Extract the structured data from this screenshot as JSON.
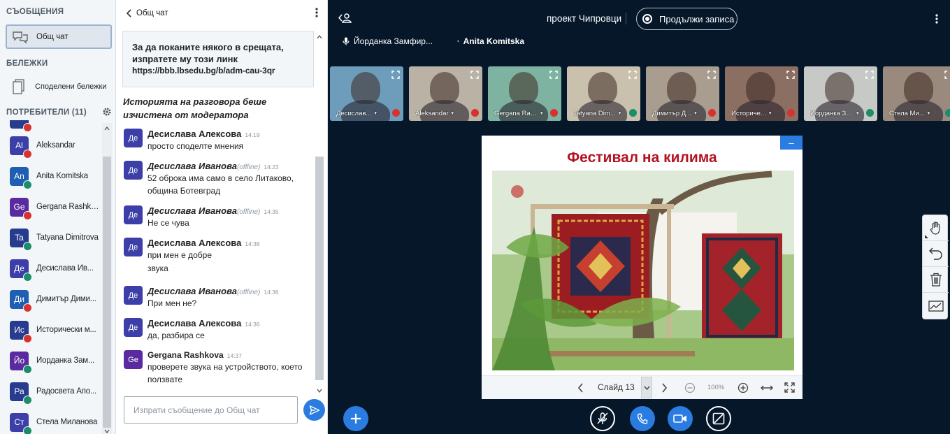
{
  "sidebar": {
    "messages_title": "СЪОБЩЕНИЯ",
    "public_chat": "Общ чат",
    "notes_title": "БЕЛЕЖКИ",
    "shared_notes": "Споделени бележки",
    "users_title": "ПОТРЕБИТЕЛИ (11)",
    "users": [
      {
        "initials": "Al",
        "name": "Aleksandar",
        "color": "#3d3fa8",
        "status": "muted"
      },
      {
        "initials": "An",
        "name": "Anita Komitska",
        "color": "#1e5fb3",
        "status": "listen"
      },
      {
        "initials": "Ge",
        "name": "Gergana Rashkova",
        "color": "#5a2ba0",
        "status": "muted"
      },
      {
        "initials": "Ta",
        "name": "Tatyana Dimitrova",
        "color": "#273c8f",
        "status": "listen"
      },
      {
        "initials": "Де",
        "name": "Десислава Ив...",
        "color": "#3d3fa8",
        "status": "listen"
      },
      {
        "initials": "Ди",
        "name": "Димитър Дими...",
        "color": "#1e5fb3",
        "status": "muted"
      },
      {
        "initials": "Ис",
        "name": "Исторически м...",
        "color": "#273c8f",
        "status": "muted"
      },
      {
        "initials": "Йо",
        "name": "Йорданка Зам...",
        "color": "#5a2ba0",
        "status": "listen"
      },
      {
        "initials": "Ра",
        "name": "Радосвета Апо...",
        "color": "#273c8f",
        "status": "listen"
      },
      {
        "initials": "Ст",
        "name": "Стела Миланова",
        "color": "#3d3fa8",
        "status": "listen"
      }
    ]
  },
  "chat": {
    "back_label": "Общ чат",
    "invite_text": "За да поканите някого в срещата, изпратете му този линк",
    "invite_link": "https://bbb.lbsedu.bg/b/adm-cau-3qr",
    "cleared_notice": "Историята на разговора беше изчистена от модератора",
    "offline_tag": "(offline)",
    "messages": [
      {
        "initials": "Де",
        "color": "#3d3fa8",
        "name": "Десислава Алексова",
        "offline": false,
        "time": "14:19",
        "lines": [
          "просто споделте мнения"
        ]
      },
      {
        "initials": "Де",
        "color": "#3d3fa8",
        "name": "Десислава Иванова",
        "offline": true,
        "time": "14:23",
        "lines": [
          "52 оброка има само в село Литаково, община Ботевград"
        ]
      },
      {
        "initials": "Де",
        "color": "#3d3fa8",
        "name": "Десислава Иванова",
        "offline": true,
        "time": "14:35",
        "lines": [
          "Не се чува"
        ]
      },
      {
        "initials": "Де",
        "color": "#3d3fa8",
        "name": "Десислава Алексова",
        "offline": false,
        "time": "14:36",
        "lines": [
          "при мен е добре",
          "звука"
        ]
      },
      {
        "initials": "Де",
        "color": "#3d3fa8",
        "name": "Десислава Иванова",
        "offline": true,
        "time": "14:36",
        "lines": [
          "При мен не?"
        ]
      },
      {
        "initials": "Де",
        "color": "#3d3fa8",
        "name": "Десислава Алексова",
        "offline": false,
        "time": "14:36",
        "lines": [
          "да, разбира се"
        ]
      },
      {
        "initials": "Ge",
        "color": "#5a2ba0",
        "name": "Gergana Rashkova",
        "offline": false,
        "time": "14:37",
        "lines": [
          "проверете звука на устройството, което ползвате"
        ]
      }
    ],
    "input_placeholder": "Изпрати съобщение до Общ чат"
  },
  "main": {
    "meeting_title": "проект Чипровци",
    "record_label": "Продължи записа",
    "talkers": [
      {
        "name": "Йорданка Замфир...",
        "color": "#4b2e9e"
      },
      {
        "name": "Anita Komitska",
        "color": "#1e63c2"
      }
    ],
    "tiles": [
      {
        "name": "Десислав...",
        "status": "muted",
        "bg": "#6e9dbb"
      },
      {
        "name": "Aleksandar",
        "status": "muted",
        "bg": "#b9b2a5"
      },
      {
        "name": "Gergana Ras...",
        "status": "muted",
        "bg": "#7fb3a1"
      },
      {
        "name": "Tatyana Dim...",
        "status": "listen",
        "bg": "#c9c0ad"
      },
      {
        "name": "Димитър Д...",
        "status": "muted",
        "bg": "#a89d8e"
      },
      {
        "name": "Историче...",
        "status": "muted",
        "bg": "#8b6f62"
      },
      {
        "name": "Йорданка За...",
        "status": "listen",
        "bg": "#c7c9c6"
      },
      {
        "name": "Стела Ми...",
        "status": "listen",
        "bg": "#9a8a7d"
      }
    ],
    "slide": {
      "title": "Фестивал на килима",
      "slide_label": "Слайд 13",
      "zoom": "100%"
    }
  },
  "colors": {
    "accent": "#2a7ce0",
    "muted": "#d8322f",
    "listen": "#1a8d6a",
    "background": "#06172a"
  },
  "icons": [
    "chat-bubbles-icon",
    "notes-icon",
    "gear-icon",
    "kebab-icon",
    "send-icon",
    "user-leave-icon",
    "record-icon",
    "mic-icon",
    "expand-icon",
    "hand-icon",
    "undo-icon",
    "trash-icon",
    "chart-icon",
    "plus-icon",
    "mute-icon",
    "phone-icon",
    "camera-icon",
    "screenshare-off-icon"
  ]
}
